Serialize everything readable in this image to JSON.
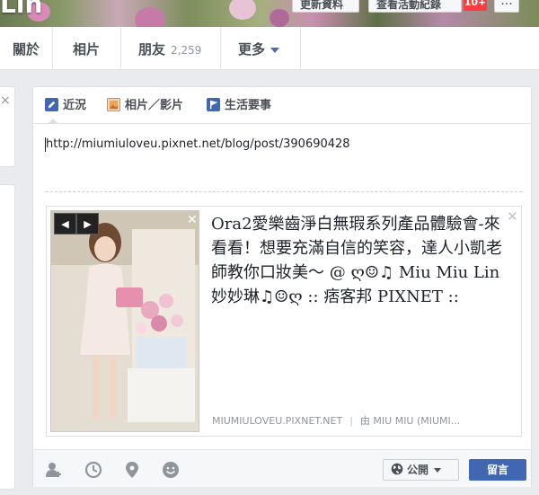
{
  "cover": {
    "name_fragment": "Lin",
    "update_info_label": "更新資料",
    "activity_log_label": "查看活動紀錄",
    "activity_badge": "10+",
    "more_dots": "..."
  },
  "nav": {
    "about": "關於",
    "photos": "相片",
    "friends": "朋友",
    "friends_count": "2,259",
    "more": "更多"
  },
  "composer": {
    "tabs": {
      "status": "近況",
      "photo_video": "相片／影片",
      "life_event": "生活要事"
    },
    "text": "http://miumiuloveu.pixnet.net/blog/post/390690428",
    "preview": {
      "prev_arrow": "◀",
      "next_arrow": "▶",
      "title": "Ora2愛樂齒淨白無瑕系列產品體驗會-來看看！想要充滿自信的笑容，達人小凱老師教你口妝美～ @ ღ☺♫ Miu Miu Lin 妙妙琳♫☺ღ :: 痞客邦 PIXNET ::",
      "domain": "MIUMIULOVEU.PIXNET.NET",
      "separator": "|",
      "author": "由 MIU MIU (MIUMI..."
    },
    "privacy_label": "公開",
    "post_label": "留言"
  },
  "colors": {
    "accent": "#4267b2",
    "badge": "#fa3e3e"
  }
}
